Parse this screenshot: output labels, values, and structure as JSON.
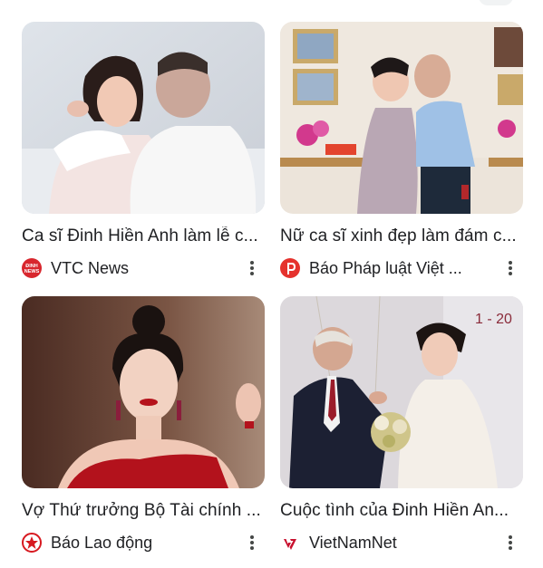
{
  "cards": [
    {
      "title": "Ca sĩ Đinh Hiền Anh làm lễ c...",
      "source": "VTC News",
      "logo_icon": "vtc-news-logo",
      "logo_text": "ĐINH NEWS",
      "logo_color": "#d8262d"
    },
    {
      "title": "Nữ ca sĩ xinh đẹp làm đám c...",
      "source": "Báo Pháp luật Việt ...",
      "logo_icon": "bao-phap-luat-logo",
      "logo_color": "#e5322d"
    },
    {
      "title": "Vợ Thứ trưởng Bộ Tài chính ...",
      "source": "Báo Lao động",
      "logo_icon": "bao-lao-dong-logo",
      "logo_color": "#d71920"
    },
    {
      "title": "Cuộc tình của Đinh Hiền An...",
      "source": "VietNamNet",
      "logo_icon": "vietnamnet-logo",
      "logo_color": "#c8102e"
    }
  ]
}
